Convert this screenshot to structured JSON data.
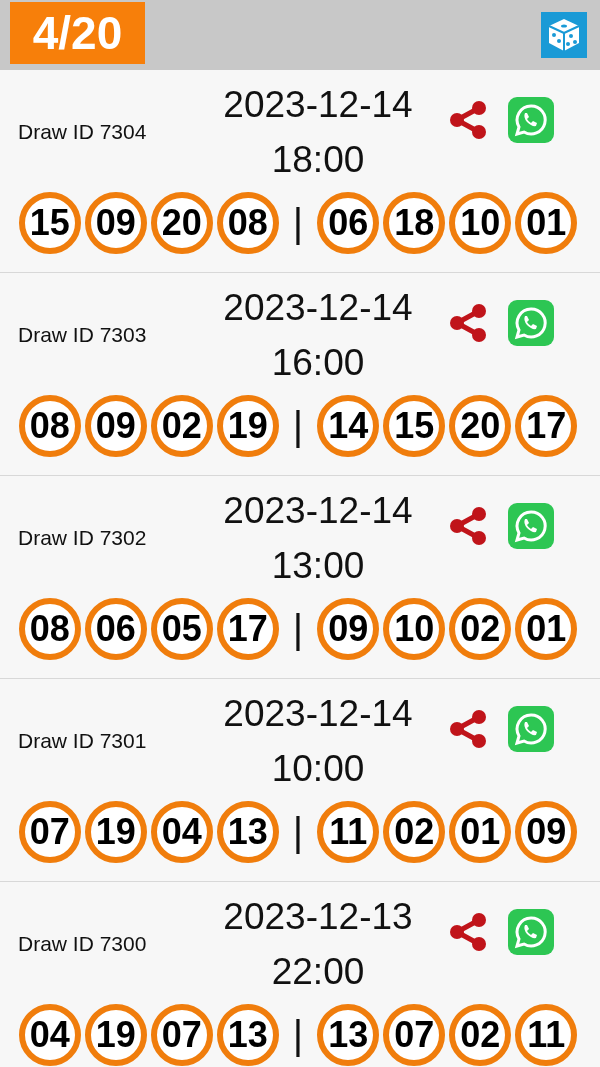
{
  "header": {
    "counter": "4/20"
  },
  "draws": [
    {
      "draw_id": "Draw ID 7304",
      "date": "2023-12-14",
      "time": "18:00",
      "first": [
        "15",
        "09",
        "20",
        "08"
      ],
      "separator": "|",
      "second": [
        "06",
        "18",
        "10",
        "01"
      ]
    },
    {
      "draw_id": "Draw ID 7303",
      "date": "2023-12-14",
      "time": "16:00",
      "first": [
        "08",
        "09",
        "02",
        "19"
      ],
      "separator": "|",
      "second": [
        "14",
        "15",
        "20",
        "17"
      ]
    },
    {
      "draw_id": "Draw ID 7302",
      "date": "2023-12-14",
      "time": "13:00",
      "first": [
        "08",
        "06",
        "05",
        "17"
      ],
      "separator": "|",
      "second": [
        "09",
        "10",
        "02",
        "01"
      ]
    },
    {
      "draw_id": "Draw ID 7301",
      "date": "2023-12-14",
      "time": "10:00",
      "first": [
        "07",
        "19",
        "04",
        "13"
      ],
      "separator": "|",
      "second": [
        "11",
        "02",
        "01",
        "09"
      ]
    },
    {
      "draw_id": "Draw ID 7300",
      "date": "2023-12-13",
      "time": "22:00",
      "first": [
        "04",
        "19",
        "07",
        "13"
      ],
      "separator": "|",
      "second": [
        "13",
        "07",
        "02",
        "11"
      ]
    }
  ]
}
